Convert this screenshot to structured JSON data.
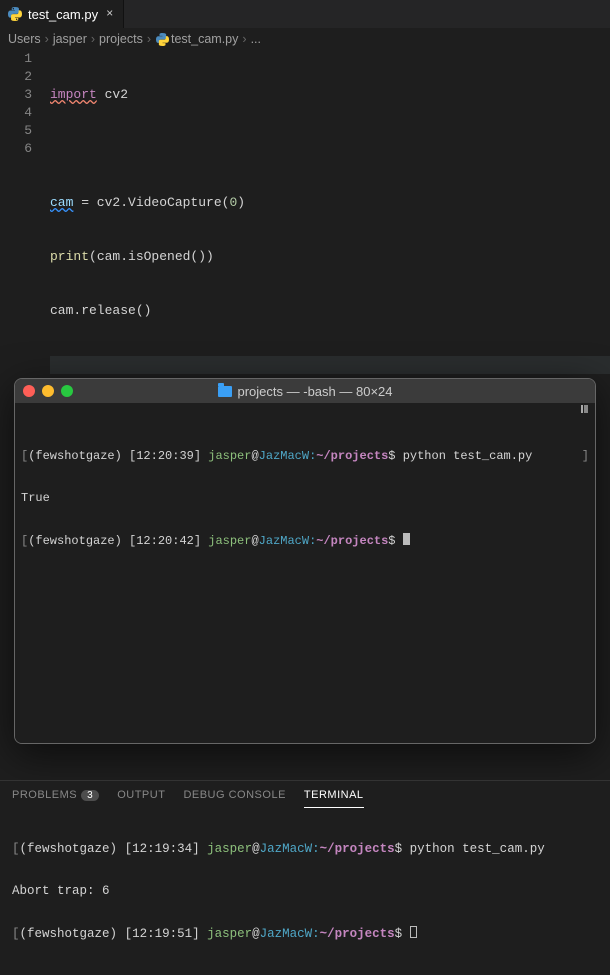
{
  "tab": {
    "filename": "test_cam.py",
    "close": "×"
  },
  "breadcrumb": {
    "parts": [
      "Users",
      "jasper",
      "projects",
      "test_cam.py",
      "..."
    ],
    "chev": "›"
  },
  "editor": {
    "lines": [
      "1",
      "2",
      "3",
      "4",
      "5",
      "6"
    ],
    "code": {
      "l1_import": "import",
      "l1_mod": " cv2",
      "l3_var": "cam",
      "l3_rest_a": " = cv2.VideoCapture(",
      "l3_num": "0",
      "l3_rest_b": ")",
      "l4_fn": "print",
      "l4_rest": "(cam.isOpened())",
      "l5": "cam.release()"
    }
  },
  "macTerminal": {
    "title": "projects — -bash — 80×24",
    "lines": [
      {
        "env": "(fewshotgaze)",
        "ts": "[12:20:39]",
        "user": "jasper",
        "host": "JazMacW:",
        "path": "~/projects",
        "cmd": "python test_cam.py"
      },
      {
        "plain": "True"
      },
      {
        "env": "(fewshotgaze)",
        "ts": "[12:20:42]",
        "user": "jasper",
        "host": "JazMacW:",
        "path": "~/projects",
        "cmd": ""
      }
    ]
  },
  "panel": {
    "tabs": {
      "problems": "PROBLEMS",
      "problemsCount": "3",
      "output": "OUTPUT",
      "debug": "DEBUG CONSOLE",
      "terminal": "TERMINAL"
    },
    "lines": [
      {
        "env": "(fewshotgaze)",
        "ts": "[12:19:34]",
        "user": "jasper",
        "host": "JazMacW:",
        "path": "~/projects",
        "cmd": "python test_cam.py"
      },
      {
        "plain": "Abort trap: 6"
      },
      {
        "env": "(fewshotgaze)",
        "ts": "[12:19:51]",
        "user": "jasper",
        "host": "JazMacW:",
        "path": "~/projects",
        "cmd": ""
      }
    ]
  }
}
